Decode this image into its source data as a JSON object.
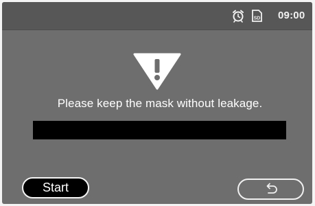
{
  "status_bar": {
    "time": "09:00",
    "icons": [
      "alarm-clock-icon",
      "sd-card-icon"
    ]
  },
  "main": {
    "warning_icon": "warning-icon",
    "message": "Please keep the mask without leakage."
  },
  "footer": {
    "start_label": "Start",
    "back_icon": "back-arrow-icon"
  },
  "colors": {
    "screen_background": "#6e6e6e",
    "status_bar_background": "#575757",
    "leakage_indicator": "#000000",
    "text": "#ffffff"
  }
}
